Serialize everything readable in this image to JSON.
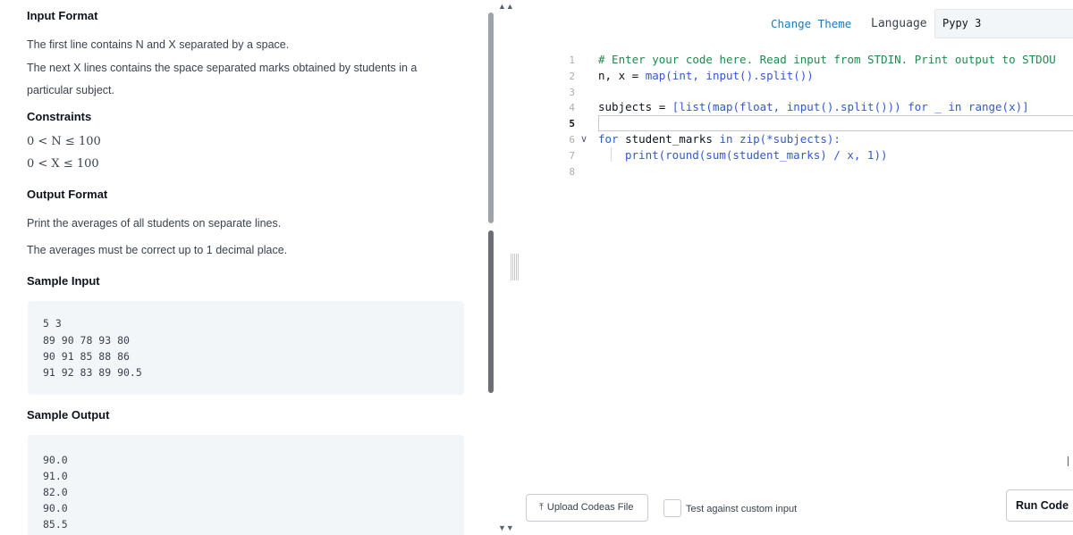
{
  "problem": {
    "input_format": {
      "heading": "Input Format",
      "line1": "The first line contains N and X separated by a space.",
      "line2": "The next X lines contains the space separated marks obtained by students in a",
      "line3": "particular subject."
    },
    "constraints": {
      "heading": "Constraints",
      "c1": "0 < N ≤ 100",
      "c2": "0 < X ≤ 100"
    },
    "output_format": {
      "heading": "Output Format",
      "line1": "Print the averages of all students on separate lines.",
      "line2": "The averages must be correct up to 1 decimal place."
    },
    "sample_input": {
      "heading": "Sample Input",
      "lines": [
        "5 3",
        "89 90 78 93 80",
        "90 91 85 88 86",
        "91 92 83 89 90.5"
      ]
    },
    "sample_output": {
      "heading": "Sample Output",
      "lines": [
        "90.0",
        "91.0",
        "82.0",
        "90.0",
        "85.5"
      ]
    }
  },
  "splitter": {
    "up_arrow": "▲▲",
    "down_arrow": "▼▼"
  },
  "editor": {
    "change_theme": "Change Theme",
    "language_label": "Language",
    "language_value": "Pypy 3",
    "line_numbers": [
      "1",
      "2",
      "3",
      "4",
      "5",
      "6",
      "7",
      "8"
    ],
    "fold_icon": "∨",
    "code": {
      "l1": "# Enter your code here. Read input from STDIN. Print output to STDOU",
      "l2_a": "n, x = ",
      "l2_b": "map(int, input().split())",
      "l4_a": "subjects = ",
      "l4_b": "[list(map(float, input().split())) for _ in range(x)]",
      "l6_a": "for",
      "l6_b": " student_marks ",
      "l6_c": "in zip(*subjects):",
      "l7_a": "print(round(sum(student_marks) / x, 1))"
    },
    "cursor_glyph": "|"
  },
  "footer": {
    "upload_icon": "⤒",
    "upload_label": "Upload Codeas File",
    "custom_input_label": "Test against custom input",
    "run_label": "Run Code"
  }
}
